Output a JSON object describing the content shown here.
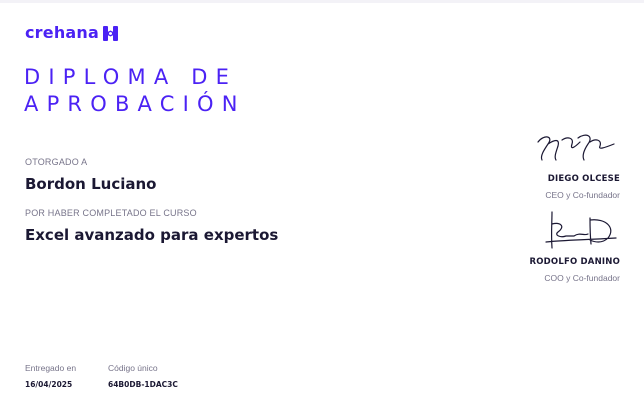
{
  "brand": {
    "name": "crehana",
    "logo_icon": "crehana-h-icon",
    "accent_color": "#4B22F4"
  },
  "title": {
    "line1": "DIPLOMA DE",
    "line2": "APROBACIÓN"
  },
  "recipient": {
    "label": "OTORGADO A",
    "name": "Bordon Luciano"
  },
  "course": {
    "label": "POR HABER COMPLETADO EL CURSO",
    "name": "Excel avanzado para expertos"
  },
  "signatories": [
    {
      "name": "DIEGO OLCESE",
      "role": "CEO y Co-fundador",
      "signature_icon": "signature-icon"
    },
    {
      "name": "RODOLFO DANINO",
      "role": "COO y Co-fundador",
      "signature_icon": "signature-icon"
    }
  ],
  "footer": {
    "delivered_label": "Entregado en",
    "delivered_date": "16/04/2025",
    "code_label": "Código único",
    "code": "64B0DB-1DAC3C"
  }
}
